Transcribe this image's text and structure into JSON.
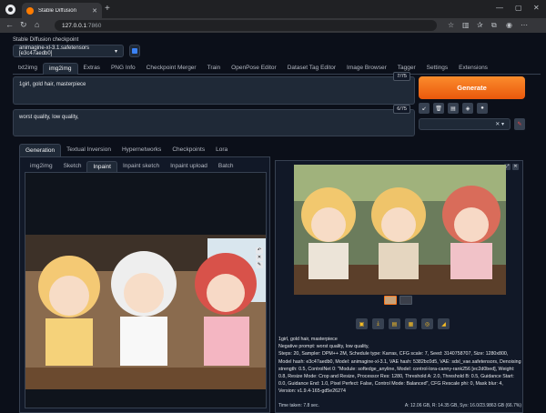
{
  "browser": {
    "tab_title": "Stable Diffusion",
    "url_host": "127.0.0.1",
    "url_port": ":7860",
    "colors": {
      "frame": "#202124",
      "toolbar": "#35363a"
    }
  },
  "checkpoint": {
    "label": "Stable Diffusion checkpoint",
    "value": "animagine-xl-3.1.safetensors [e3c47aedb0]"
  },
  "main_tabs": [
    "txt2img",
    "img2img",
    "Extras",
    "PNG Info",
    "Checkpoint Merger",
    "Train",
    "OpenPose Editor",
    "Dataset Tag Editor",
    "Image Browser",
    "Tagger",
    "Settings",
    "Extensions"
  ],
  "positive_prompt": {
    "text": "1girl, gold hair, masterpiece",
    "tokens": "7/75"
  },
  "negative_prompt": {
    "text": "worst quality, low quality,",
    "tokens": "6/75"
  },
  "generate_label": "Generate",
  "accent_color": "#f97316",
  "sub_tabs": [
    "Generation",
    "Textual Inversion",
    "Hypernetworks",
    "Checkpoints",
    "Lora"
  ],
  "inner_tabs": [
    "img2img",
    "Sketch",
    "Inpaint",
    "Inpaint sketch",
    "Inpaint upload",
    "Batch"
  ],
  "output": {
    "prompt": "1girl, gold hair, masterpiece",
    "negative": "Negative prompt: worst quality, low quality,",
    "params": "Steps: 20, Sampler: DPM++ 2M, Schedule type: Karras, CFG scale: 7, Seed: 3140758707, Size: 1280x800, Model hash: e3c47aedb0, Model: animagine-xl-3.1, VAE hash: 5382bc0d5, VAE: sdxl_vae.safetensors, Denoising strength: 0.5, ControlNet 0: \"Module: softedge_anyline, Model: control-lora-canny-rank256 [ec2d0bed], Weight: 0.8, Resize Mode: Crop and Resize, Processor Res: 1280, Threshold A: 2.0, Threshold B: 0.5, Guidance Start: 0.0, Guidance End: 1.0, Pixel Perfect: False, Control Mode: Balanced\", CFG Rescale phi: 0, Mask blur: 4, Version: v1.9.4-165-gd5e26274",
    "time_taken": "Time taken: 7.8 sec.",
    "memory": "A: 12.06 GB, R: 14.35 GB, Sys: 16.0/23.9863 GB (66.7%)"
  }
}
